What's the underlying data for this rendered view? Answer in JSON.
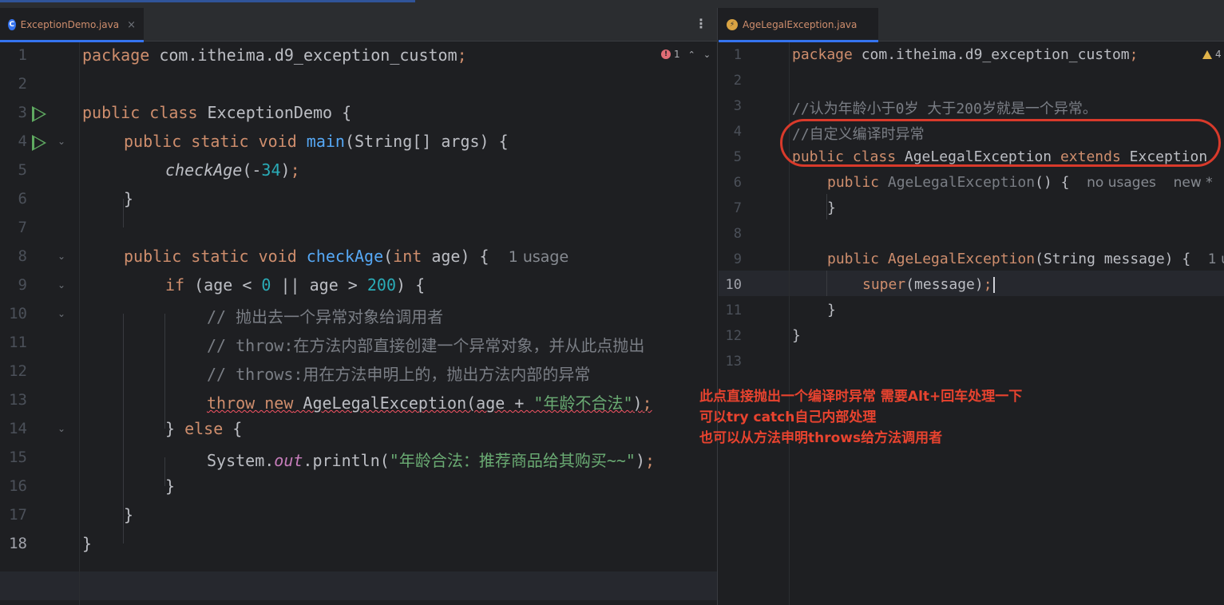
{
  "left_tab": {
    "icon": "class-icon",
    "filename": "ExceptionDemo.java",
    "close": "×",
    "menu": "⋮",
    "inspection": {
      "errors": "1",
      "up": "⌃",
      "down": "⌄"
    }
  },
  "right_tab": {
    "icon": "exception-class-icon",
    "filename": "AgeLegalException.java",
    "inspection": {
      "warnings": "4"
    }
  },
  "left_code": {
    "line_numbers": [
      "1",
      "2",
      "3",
      "4",
      "5",
      "6",
      "7",
      "8",
      "9",
      "10",
      "11",
      "12",
      "13",
      "14",
      "15",
      "16",
      "17",
      "18"
    ],
    "current_line": "18",
    "l1_kw": "package",
    "l1_pkg": " com.itheima.d9_exception_custom",
    "l1_semi": ";",
    "l3_kw": "public class",
    "l3_name": " ExceptionDemo {",
    "l4_kw": "public static void",
    "l4_fn": "main",
    "l4_rest": "(String[] args) {",
    "l5_fn": "checkAge",
    "l5_open": "(-",
    "l5_num": "34",
    "l5_close": ")",
    "l5_semi": ";",
    "l6": "}",
    "l8_kw": "public static void",
    "l8_fn": "checkAge",
    "l8_open": "(",
    "l8_type": "int",
    "l8_rest": " age) {",
    "l8_hint": "1 usage",
    "l9_kw": "if",
    "l9_a": " (age < ",
    "l9_n0": "0",
    "l9_b": " || age > ",
    "l9_n200": "200",
    "l9_c": ") {",
    "l10": "// 抛出去一个异常对象给调用者",
    "l11": "// throw:在方法内部直接创建一个异常对象，并从此点抛出",
    "l12": "// throws:用在方法申明上的，抛出方法内部的异常",
    "l13_kw": "throw new",
    "l13_rest": " AgeLegalException(age + ",
    "l13_str": "\"年龄不合法\"",
    "l13_close": ")",
    "l13_semi": ";",
    "l14_a": "} ",
    "l14_kw": "else",
    "l14_b": " {",
    "l15_a": "System.",
    "l15_out": "out",
    "l15_b": ".println(",
    "l15_str": "\"年龄合法：推荐商品给其购买~~\"",
    "l15_close": ")",
    "l15_semi": ";",
    "l16": "}",
    "l17": "}",
    "l18": "}"
  },
  "right_code": {
    "line_numbers": [
      "1",
      "2",
      "3",
      "4",
      "5",
      "6",
      "7",
      "8",
      "9",
      "10",
      "11",
      "12",
      "13"
    ],
    "current_line": "10",
    "l1_kw": "package",
    "l1_pkg": " com.itheima.d9_exception_custom",
    "l1_semi": ";",
    "l3": "//认为年龄小于0岁 大于200岁就是一个异常。",
    "l4": "//自定义编译时异常",
    "l5_kw": "public class",
    "l5_name": " AgeLegalException ",
    "l5_ext": "extends",
    "l5_base": " Exception ",
    "l6_kw": "public",
    "l6_name": " AgeLegalException",
    "l6_rest": "() {",
    "l6_hint1": "no usages",
    "l6_hint2": "new *",
    "l7": "}",
    "l9_kw": "public",
    "l9_name": " AgeLegalException",
    "l9_rest": "(String message) {",
    "l9_hint": "1 u",
    "l10_kw": "super",
    "l10_rest": "(message)",
    "l10_semi": ";",
    "l11": "}",
    "l12": "}"
  },
  "annotation": {
    "line1": "此点直接抛出一个编译时异常 需要Alt+回车处理一下",
    "line2": "可以try catch自己内部处理",
    "line3": "也可以从方法申明throws给方法调用者",
    "color": "#e8432f"
  },
  "colors": {
    "keyword": "#cf8e6d",
    "function": "#56a8f5",
    "number": "#2aacb8",
    "string": "#6aab73",
    "comment": "#7a7e85",
    "field": "#c77dbb",
    "run": "#5faa61"
  }
}
